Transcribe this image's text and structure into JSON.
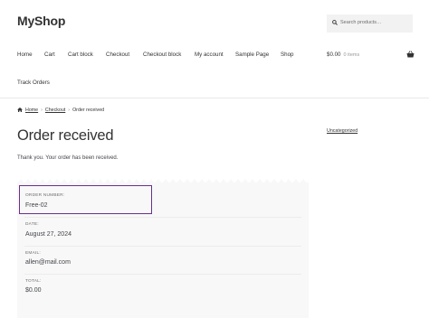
{
  "header": {
    "site_title": "MyShop",
    "search_placeholder": "Search products…"
  },
  "nav": {
    "items": [
      "Home",
      "Cart",
      "Cart block",
      "Checkout",
      "Checkout block",
      "My account",
      "Sample Page",
      "Shop",
      "Track Orders"
    ]
  },
  "cart": {
    "total": "$0.00",
    "count": "0 items"
  },
  "breadcrumb": {
    "home": "Home",
    "checkout": "Checkout",
    "current": "Order received"
  },
  "page": {
    "title": "Order received",
    "message": "Thank you. Your order has been received."
  },
  "sidebar": {
    "category_link": "Uncategorized"
  },
  "order": {
    "number_label": "ORDER NUMBER:",
    "number": "Free-02",
    "date_label": "DATE:",
    "date": "August 27, 2024",
    "email_label": "EMAIL:",
    "email": "allen@mail.com",
    "total_label": "TOTAL:",
    "total": "$0.00"
  },
  "colors": {
    "accent": "#6a2f8f",
    "text": "#43454b",
    "heading": "#333333"
  }
}
